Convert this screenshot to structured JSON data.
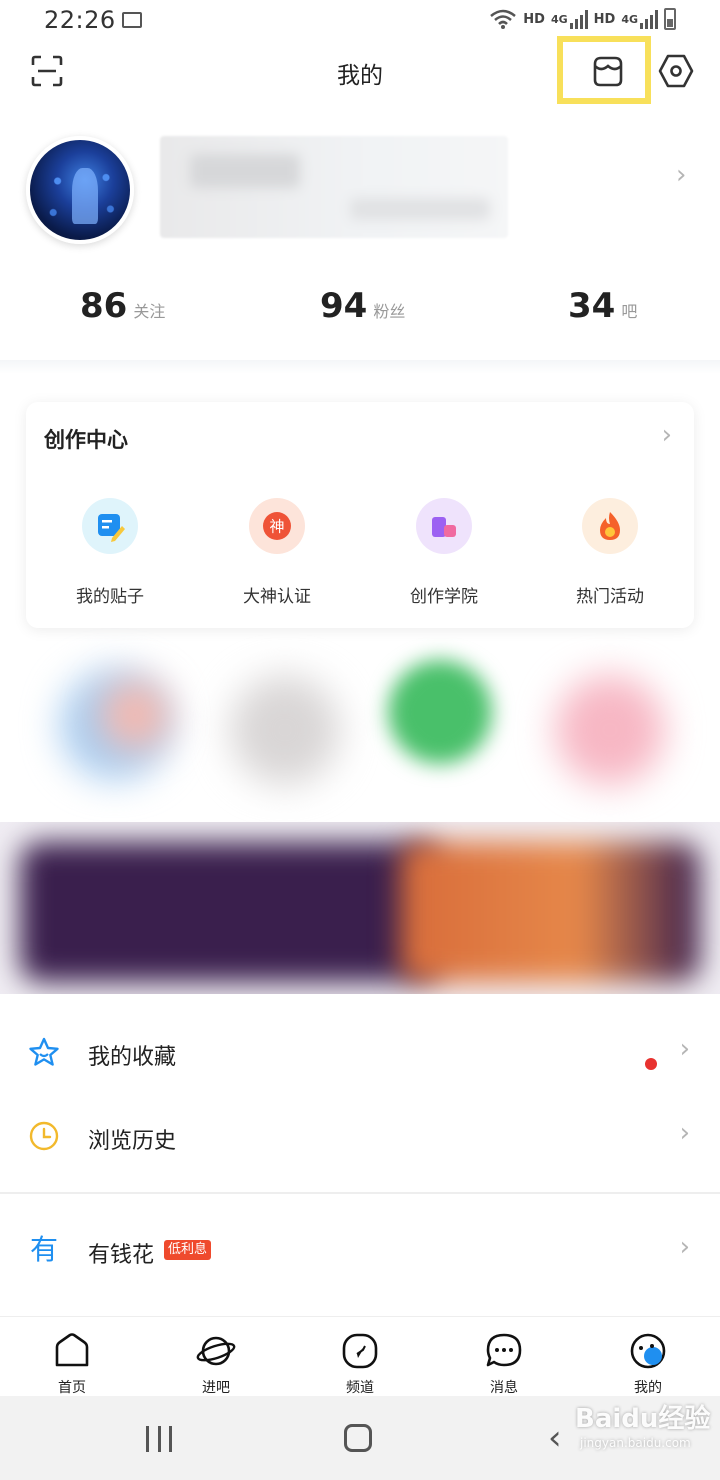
{
  "status_bar": {
    "time": "22:26",
    "net1": "HD",
    "net1_type": "4G",
    "net2": "HD",
    "net2_type": "4G"
  },
  "header": {
    "title": "我的"
  },
  "profile": {
    "stats": [
      {
        "value": "86",
        "label": "关注"
      },
      {
        "value": "94",
        "label": "粉丝"
      },
      {
        "value": "34",
        "label": "吧"
      }
    ]
  },
  "creation_center": {
    "title": "创作中心",
    "items": [
      {
        "label": "我的贴子",
        "icon": "post-edit-icon",
        "color": "#1f8ff0"
      },
      {
        "label": "大神认证",
        "icon": "god-badge-icon",
        "color": "#ef5337"
      },
      {
        "label": "创作学院",
        "icon": "academy-icon",
        "color": "#9c61f2"
      },
      {
        "label": "热门活动",
        "icon": "fire-icon",
        "color": "#f5612a"
      }
    ],
    "item_glyph_god": "神"
  },
  "list": {
    "favorites": "我的收藏",
    "history": "浏览历史",
    "loan": "有钱花",
    "loan_badge": "低利息",
    "loan_glyph": "有"
  },
  "tabs": [
    {
      "label": "首页",
      "icon": "home-icon"
    },
    {
      "label": "进吧",
      "icon": "planet-icon"
    },
    {
      "label": "频道",
      "icon": "compass-icon"
    },
    {
      "label": "消息",
      "icon": "message-icon"
    },
    {
      "label": "我的",
      "icon": "profile-face-icon"
    }
  ],
  "watermark": {
    "text": "Baidu经验",
    "sub": "jingyan.baidu.com"
  },
  "colors": {
    "highlight": "#f8e05a",
    "accent_blue": "#1f8ff0",
    "red_dot": "#e8322f",
    "badge": "#ef4a2d"
  }
}
